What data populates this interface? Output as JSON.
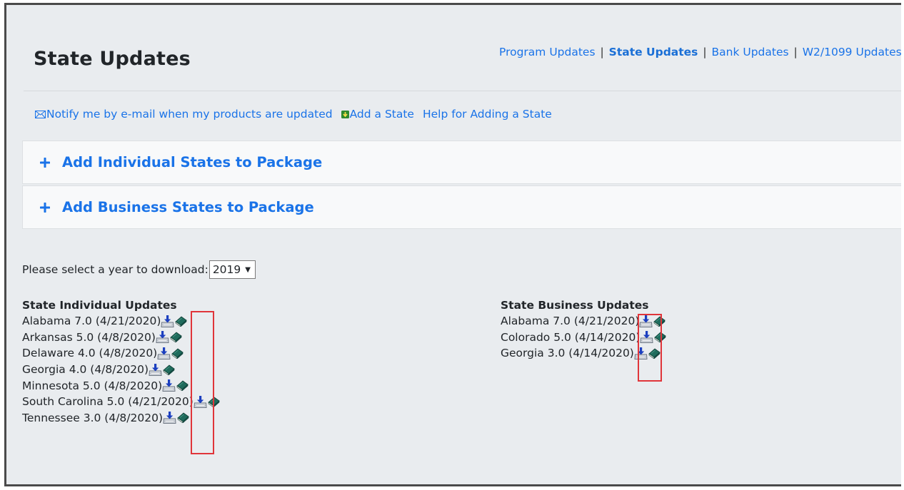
{
  "page": {
    "corner_mark": "ʹ",
    "title": "State Updates"
  },
  "topnav": {
    "links": [
      "Program Updates",
      "State Updates",
      "Bank Updates",
      "W2/1099 Updates"
    ],
    "separator": "|"
  },
  "actions": {
    "notify": "Notify me by e-mail when my products are updated",
    "add_state": "Add a State",
    "help": "Help for Adding a State"
  },
  "panels": {
    "individual": "Add Individual States to Package",
    "business": "Add Business States to Package"
  },
  "year_select": {
    "label": "Please select a year to download:",
    "selected": "2019"
  },
  "individual_updates": {
    "title": "State Individual Updates",
    "items": [
      {
        "label": "Alabama 7.0  (4/21/2020)"
      },
      {
        "label": "Arkansas 5.0  (4/8/2020)"
      },
      {
        "label": "Delaware 4.0  (4/8/2020)"
      },
      {
        "label": "Georgia 4.0  (4/8/2020)"
      },
      {
        "label": "Minnesota 5.0  (4/8/2020)"
      },
      {
        "label": "South Carolina 5.0  (4/21/2020)"
      },
      {
        "label": "Tennessee 3.0  (4/8/2020)"
      }
    ]
  },
  "business_updates": {
    "title": "State Business Updates",
    "items": [
      {
        "label": "Alabama 7.0  (4/21/2020)"
      },
      {
        "label": "Colorado 5.0  (4/14/2020)"
      },
      {
        "label": "Georgia 3.0  (4/14/2020)"
      }
    ]
  },
  "icons": {
    "mail": "envelope-icon",
    "add": "add-state-icon",
    "expand": "plus-icon",
    "download": "download-icon",
    "book": "book-icon"
  },
  "colors": {
    "link": "#1a73e8",
    "highlight": "#e0353a",
    "background": "#e9ecef"
  }
}
